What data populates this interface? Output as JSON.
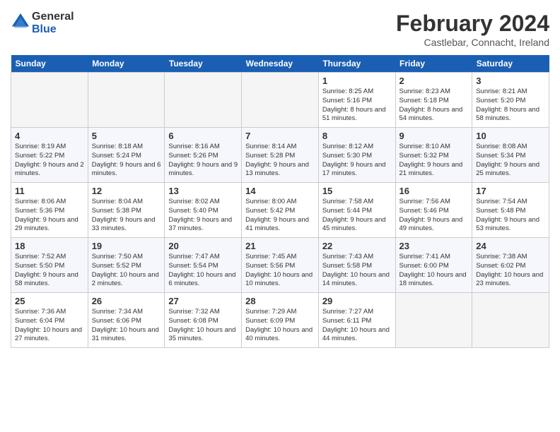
{
  "header": {
    "logo_general": "General",
    "logo_blue": "Blue",
    "month_title": "February 2024",
    "location": "Castlebar, Connacht, Ireland"
  },
  "days_of_week": [
    "Sunday",
    "Monday",
    "Tuesday",
    "Wednesday",
    "Thursday",
    "Friday",
    "Saturday"
  ],
  "weeks": [
    [
      {
        "day": "",
        "info": ""
      },
      {
        "day": "",
        "info": ""
      },
      {
        "day": "",
        "info": ""
      },
      {
        "day": "",
        "info": ""
      },
      {
        "day": "1",
        "info": "Sunrise: 8:25 AM\nSunset: 5:16 PM\nDaylight: 8 hours and 51 minutes."
      },
      {
        "day": "2",
        "info": "Sunrise: 8:23 AM\nSunset: 5:18 PM\nDaylight: 8 hours and 54 minutes."
      },
      {
        "day": "3",
        "info": "Sunrise: 8:21 AM\nSunset: 5:20 PM\nDaylight: 8 hours and 58 minutes."
      }
    ],
    [
      {
        "day": "4",
        "info": "Sunrise: 8:19 AM\nSunset: 5:22 PM\nDaylight: 9 hours and 2 minutes."
      },
      {
        "day": "5",
        "info": "Sunrise: 8:18 AM\nSunset: 5:24 PM\nDaylight: 9 hours and 6 minutes."
      },
      {
        "day": "6",
        "info": "Sunrise: 8:16 AM\nSunset: 5:26 PM\nDaylight: 9 hours and 9 minutes."
      },
      {
        "day": "7",
        "info": "Sunrise: 8:14 AM\nSunset: 5:28 PM\nDaylight: 9 hours and 13 minutes."
      },
      {
        "day": "8",
        "info": "Sunrise: 8:12 AM\nSunset: 5:30 PM\nDaylight: 9 hours and 17 minutes."
      },
      {
        "day": "9",
        "info": "Sunrise: 8:10 AM\nSunset: 5:32 PM\nDaylight: 9 hours and 21 minutes."
      },
      {
        "day": "10",
        "info": "Sunrise: 8:08 AM\nSunset: 5:34 PM\nDaylight: 9 hours and 25 minutes."
      }
    ],
    [
      {
        "day": "11",
        "info": "Sunrise: 8:06 AM\nSunset: 5:36 PM\nDaylight: 9 hours and 29 minutes."
      },
      {
        "day": "12",
        "info": "Sunrise: 8:04 AM\nSunset: 5:38 PM\nDaylight: 9 hours and 33 minutes."
      },
      {
        "day": "13",
        "info": "Sunrise: 8:02 AM\nSunset: 5:40 PM\nDaylight: 9 hours and 37 minutes."
      },
      {
        "day": "14",
        "info": "Sunrise: 8:00 AM\nSunset: 5:42 PM\nDaylight: 9 hours and 41 minutes."
      },
      {
        "day": "15",
        "info": "Sunrise: 7:58 AM\nSunset: 5:44 PM\nDaylight: 9 hours and 45 minutes."
      },
      {
        "day": "16",
        "info": "Sunrise: 7:56 AM\nSunset: 5:46 PM\nDaylight: 9 hours and 49 minutes."
      },
      {
        "day": "17",
        "info": "Sunrise: 7:54 AM\nSunset: 5:48 PM\nDaylight: 9 hours and 53 minutes."
      }
    ],
    [
      {
        "day": "18",
        "info": "Sunrise: 7:52 AM\nSunset: 5:50 PM\nDaylight: 9 hours and 58 minutes."
      },
      {
        "day": "19",
        "info": "Sunrise: 7:50 AM\nSunset: 5:52 PM\nDaylight: 10 hours and 2 minutes."
      },
      {
        "day": "20",
        "info": "Sunrise: 7:47 AM\nSunset: 5:54 PM\nDaylight: 10 hours and 6 minutes."
      },
      {
        "day": "21",
        "info": "Sunrise: 7:45 AM\nSunset: 5:56 PM\nDaylight: 10 hours and 10 minutes."
      },
      {
        "day": "22",
        "info": "Sunrise: 7:43 AM\nSunset: 5:58 PM\nDaylight: 10 hours and 14 minutes."
      },
      {
        "day": "23",
        "info": "Sunrise: 7:41 AM\nSunset: 6:00 PM\nDaylight: 10 hours and 18 minutes."
      },
      {
        "day": "24",
        "info": "Sunrise: 7:38 AM\nSunset: 6:02 PM\nDaylight: 10 hours and 23 minutes."
      }
    ],
    [
      {
        "day": "25",
        "info": "Sunrise: 7:36 AM\nSunset: 6:04 PM\nDaylight: 10 hours and 27 minutes."
      },
      {
        "day": "26",
        "info": "Sunrise: 7:34 AM\nSunset: 6:06 PM\nDaylight: 10 hours and 31 minutes."
      },
      {
        "day": "27",
        "info": "Sunrise: 7:32 AM\nSunset: 6:08 PM\nDaylight: 10 hours and 35 minutes."
      },
      {
        "day": "28",
        "info": "Sunrise: 7:29 AM\nSunset: 6:09 PM\nDaylight: 10 hours and 40 minutes."
      },
      {
        "day": "29",
        "info": "Sunrise: 7:27 AM\nSunset: 6:11 PM\nDaylight: 10 hours and 44 minutes."
      },
      {
        "day": "",
        "info": ""
      },
      {
        "day": "",
        "info": ""
      }
    ]
  ]
}
